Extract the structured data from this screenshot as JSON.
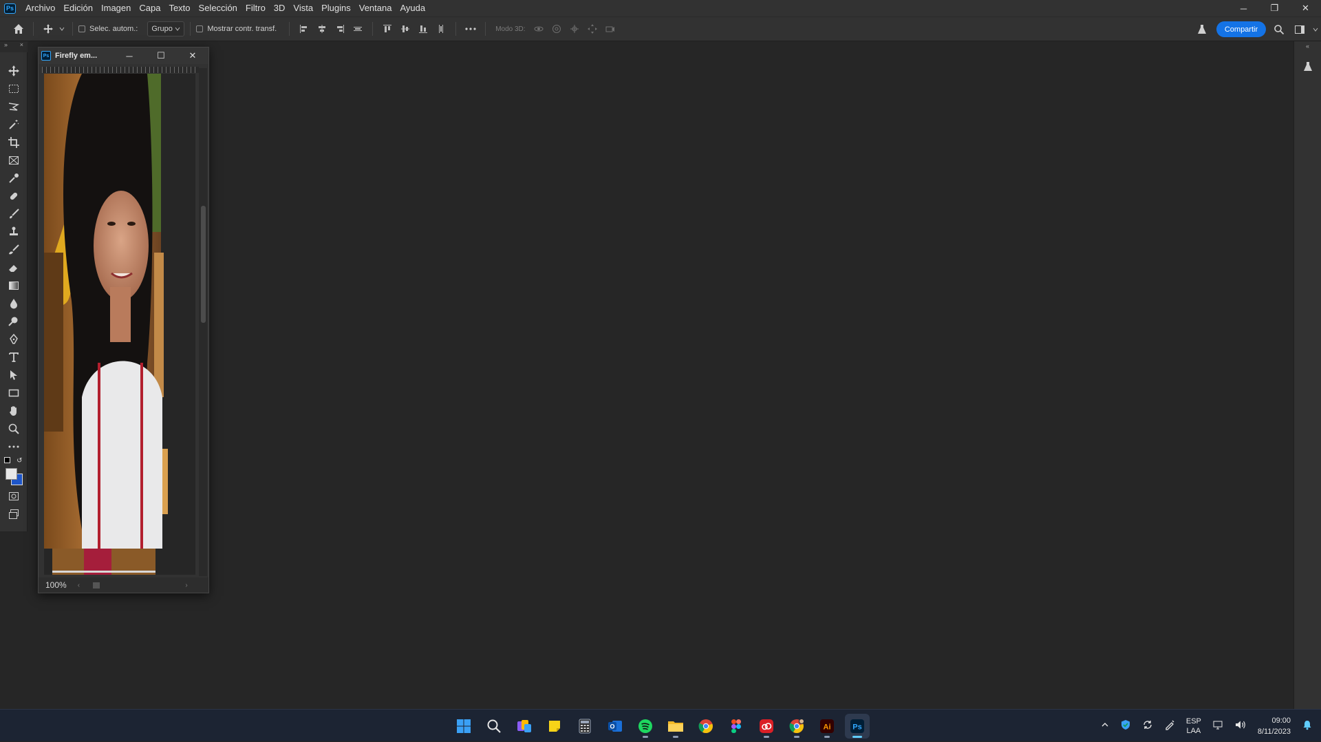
{
  "menubar": {
    "items": [
      "Archivo",
      "Edición",
      "Imagen",
      "Capa",
      "Texto",
      "Selección",
      "Filtro",
      "3D",
      "Vista",
      "Plugins",
      "Ventana",
      "Ayuda"
    ],
    "window_controls": [
      "─",
      "❐",
      "✕"
    ]
  },
  "options": {
    "auto_select_label": "Selec. autom.:",
    "auto_select_value": "Grupo",
    "show_transform_label": "Mostrar contr. transf.",
    "mode_3d_label": "Modo 3D:",
    "share_label": "Compartir"
  },
  "document": {
    "title": "Firefly em...",
    "zoom": "100%"
  },
  "taskbar": {
    "lang_primary": "ESP",
    "lang_secondary": "LAA",
    "time": "09:00",
    "date": "8/11/2023"
  },
  "colors": {
    "accent": "#1473e6",
    "ps_blue": "#31a8ff",
    "ps_dark": "#001e36",
    "workspace": "#262626",
    "panel": "#323232"
  }
}
